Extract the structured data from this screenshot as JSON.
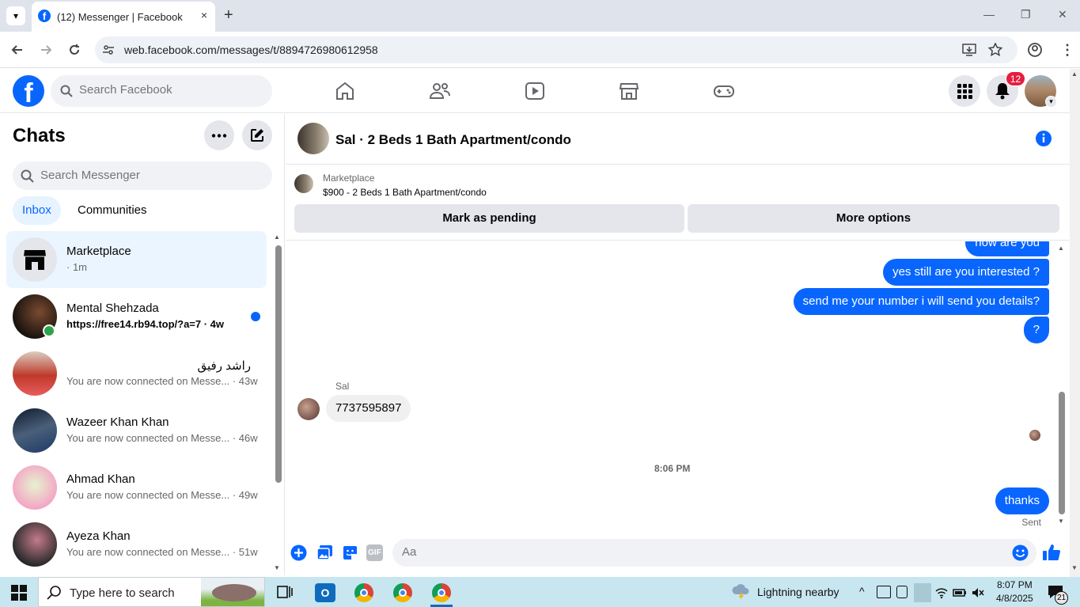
{
  "browser": {
    "tab_title": "(12) Messenger | Facebook",
    "tab_close": "×",
    "new_tab": "+",
    "url": "web.facebook.com/messages/t/8894726980612958"
  },
  "fb": {
    "search_placeholder": "Search Facebook",
    "notif_count": "12",
    "logo": "f"
  },
  "sidebar": {
    "title": "Chats",
    "search_placeholder": "Search Messenger",
    "tabs": [
      "Inbox",
      "Communities"
    ],
    "chats": [
      {
        "name": "Marketplace",
        "preview": "· 1m"
      },
      {
        "name": "Mental Shehzada",
        "preview": "https://free14.rb94.top/?a=7 · 4w"
      },
      {
        "name": "راشد رفیق",
        "preview": "You are now connected on Messe... · 43w"
      },
      {
        "name": "Wazeer Khan Khan",
        "preview": "You are now connected on Messe... · 46w"
      },
      {
        "name": "Ahmad Khan",
        "preview": "You are now connected on Messe... · 49w"
      },
      {
        "name": "Ayeza Khan",
        "preview": "You are now connected on Messe... · 51w"
      }
    ]
  },
  "conversation": {
    "title": "Sal · 2 Beds 1 Bath Apartment/condo",
    "marketplace_label": "Marketplace",
    "listing": "$900 - 2 Beds 1 Bath Apartment/condo",
    "mark_pending": "Mark as pending",
    "more_options": "More options",
    "messages_out": [
      "how are you",
      "yes still are you interested ?",
      "send me your number i will send you details?",
      "?"
    ],
    "sender_name": "Sal",
    "incoming": "7737595897",
    "time_divider": "8:06 PM",
    "last_out": "thanks",
    "status": "Sent",
    "composer_placeholder": "Aa",
    "gif_label": "GIF"
  },
  "taskbar": {
    "search_placeholder": "Type here to search",
    "weather": "Lightning nearby",
    "time": "8:07 PM",
    "date": "4/8/2025",
    "notif": "21"
  }
}
